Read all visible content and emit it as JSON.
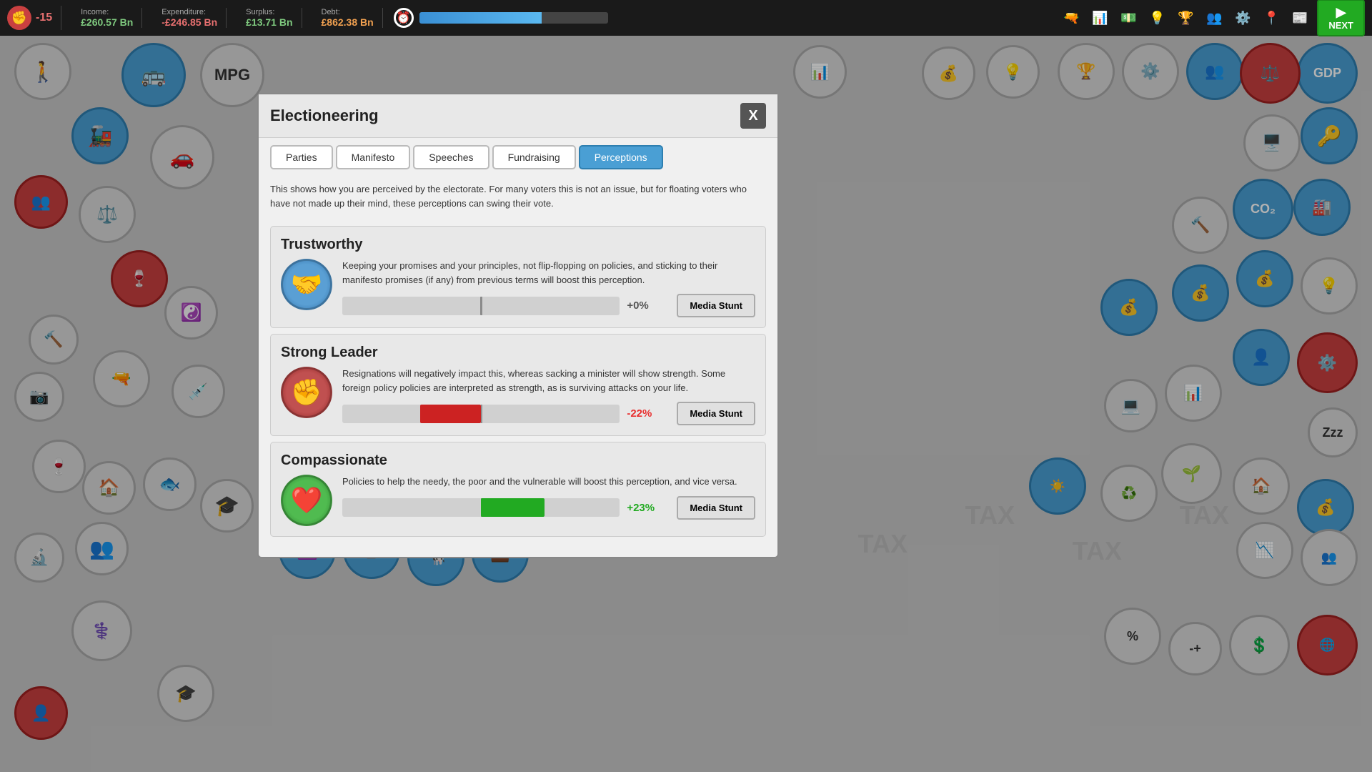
{
  "topbar": {
    "approval_label": "-15",
    "income_label": "Income:",
    "income_value": "£260.57 Bn",
    "expenditure_label": "Expenditure:",
    "expenditure_value": "-£246.85 Bn",
    "surplus_label": "Surplus:",
    "surplus_value": "£13.71 Bn",
    "debt_label": "Debt:",
    "debt_value": "£862.38 Bn",
    "approval_bar_pct": 65,
    "next_label": "NEXT"
  },
  "modal": {
    "title": "Electioneering",
    "close_label": "X",
    "description": "This shows how you are perceived by the electorate. For many voters this is not an issue, but for floating voters who have not made up their mind, these perceptions can swing their vote.",
    "tabs": [
      {
        "label": "Parties",
        "active": false
      },
      {
        "label": "Manifesto",
        "active": false
      },
      {
        "label": "Speeches",
        "active": false
      },
      {
        "label": "Fundraising",
        "active": false
      },
      {
        "label": "Perceptions",
        "active": true
      }
    ],
    "perceptions": [
      {
        "title": "Trustworthy",
        "description": "Keeping your promises and your principles, not flip-flopping on policies, and sticking to their manifesto promises (if any) from previous terms will boost this perception.",
        "value": "+0%",
        "value_class": "value-neutral",
        "bar_type": "zero",
        "icon": "🤝",
        "icon_class": "trustworthy",
        "media_stunt_label": "Media Stunt"
      },
      {
        "title": "Strong Leader",
        "description": "Resignations will negatively impact this, whereas sacking a minister will show strength. Some foreign policy policies are interpreted as strength, as is surviving attacks on your life.",
        "value": "-22%",
        "value_class": "value-negative",
        "bar_type": "negative",
        "bar_pct": 22,
        "icon": "✊",
        "icon_class": "strong",
        "media_stunt_label": "Media Stunt"
      },
      {
        "title": "Compassionate",
        "description": "Policies to help the needy, the poor and the vulnerable will boost this perception, and vice versa.",
        "value": "+23%",
        "value_class": "value-positive",
        "bar_type": "positive",
        "bar_pct": 23,
        "icon": "❤️",
        "icon_class": "compassionate",
        "media_stunt_label": "Media Stunt"
      }
    ]
  }
}
